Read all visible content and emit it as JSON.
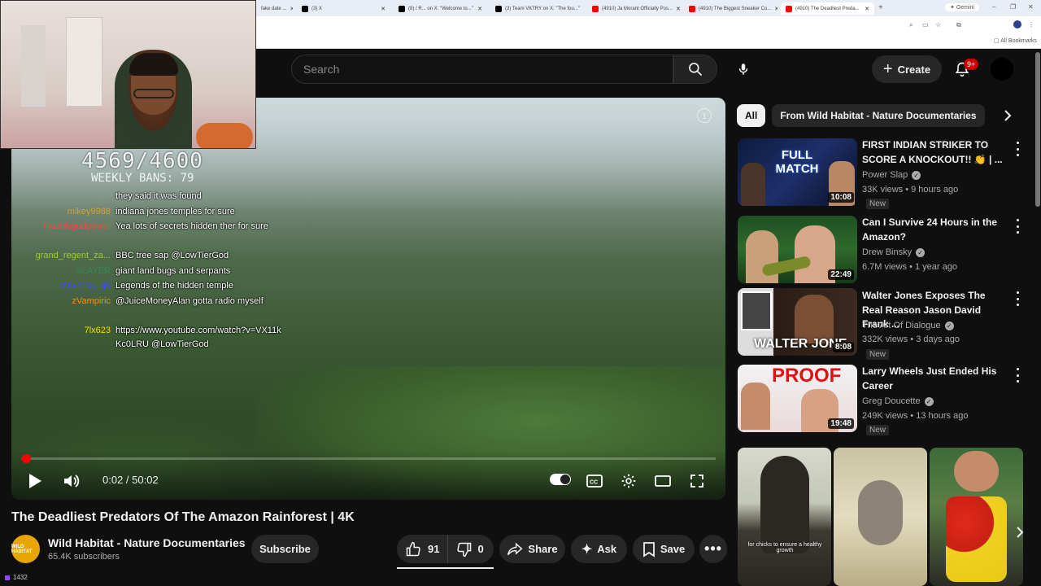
{
  "browser": {
    "tabs": [
      {
        "label": "fake date ...",
        "color": "#888888"
      },
      {
        "label": "(3) X",
        "color": "#000000"
      },
      {
        "label": "(8) / R... on X: \"Welcome to...\"",
        "color": "#000000"
      },
      {
        "label": "(3) Team VKTRY on X: \"The fou...\"",
        "color": "#000000"
      },
      {
        "label": "(4910) Ja Morant Officially Pos...",
        "color": "#ff0000"
      },
      {
        "label": "(4910) The Biggest Sneaker Co...",
        "color": "#ff0000"
      },
      {
        "label": "(4910) The Deadliest Preda...",
        "color": "#ff0000"
      }
    ],
    "gemini_label": "Gemini",
    "all_bookmarks_label": "All Bookmarks"
  },
  "masthead": {
    "search_placeholder": "Search",
    "create_label": "Create",
    "notification_count": "9+"
  },
  "chat": {
    "counter": "4569/4600",
    "weekly": "WEEKLY BANS: 79",
    "messages": [
      {
        "user": "",
        "color": "#ffffff",
        "text": "they said it was found"
      },
      {
        "user": "mikey9988",
        "color": "#d4a03a",
        "text": "indiana jones temples for sure"
      },
      {
        "user": "musclegodpower",
        "color": "#ff4444",
        "text": "Yea lots of secrets hidden ther for sure"
      },
      {
        "user": "grand_regent_za...",
        "color": "#9acd32",
        "text": "BBC tree sap @LowTierGod"
      },
      {
        "user": "SLAYER",
        "color": "#2e8b57",
        "text": "giant land bugs and serpants"
      },
      {
        "user": "maverick_g6",
        "color": "#3a4bff",
        "text": "Legends of the hidden temple"
      },
      {
        "user": "zVampiric",
        "color": "#ff8c00",
        "text": "@JuiceMoneyAlan gotta radio myself"
      },
      {
        "user": "7lx623",
        "color": "#ffd700",
        "text": "https://www.youtube.com/watch?v=VX11kKc0LRU @LowTierGod"
      }
    ]
  },
  "player": {
    "time_current": "0:02",
    "time_total": "50:02",
    "time_display": "0:02 / 50:02",
    "progress_fraction": 0.0007
  },
  "video": {
    "title": "The Deadliest Predators Of The Amazon Rainforest | 4K",
    "channel": "Wild Habitat - Nature Documentaries",
    "channel_avatar_text": "WILD HABITAT",
    "subscribers": "65.4K subscribers",
    "subscribe_label": "Subscribe",
    "likes": "91",
    "dislikes": "0",
    "share_label": "Share",
    "ask_label": "Ask",
    "save_label": "Save"
  },
  "viewer_count": "1432",
  "chips": [
    {
      "label": "All",
      "active": true
    },
    {
      "label": "From Wild Habitat - Nature Documentaries",
      "active": false
    }
  ],
  "recommendations": [
    {
      "title": "FIRST INDIAN STRIKER TO SCORE A KNOCKOUT!! 👏 | ...",
      "channel": "Power Slap",
      "verified": true,
      "meta": "33K views • 9 hours ago",
      "new": "New",
      "duration": "10:08",
      "thumb_text": "FULL MATCH"
    },
    {
      "title": "Can I Survive 24 Hours in the Amazon?",
      "channel": "Drew Binsky",
      "verified": true,
      "meta": "6.7M views • 1 year ago",
      "new": "",
      "duration": "22:49",
      "thumb_text": ""
    },
    {
      "title": "Walter Jones Exposes The Real Reason Jason David Frank ...",
      "channel": "The Art Of Dialogue",
      "verified": true,
      "meta": "332K views • 3 days ago",
      "new": "New",
      "duration": "8:08",
      "thumb_text": "WALTER JONE"
    },
    {
      "title": "Larry Wheels Just Ended His Career",
      "channel": "Greg Doucette",
      "verified": true,
      "meta": "249K views • 13 hours ago",
      "new": "New",
      "duration": "19:48",
      "thumb_text": "PROOF"
    }
  ],
  "shorts": [
    {
      "caption": "for chicks to ensure a healthy growth"
    },
    {
      "caption": ""
    },
    {
      "caption": ""
    }
  ]
}
